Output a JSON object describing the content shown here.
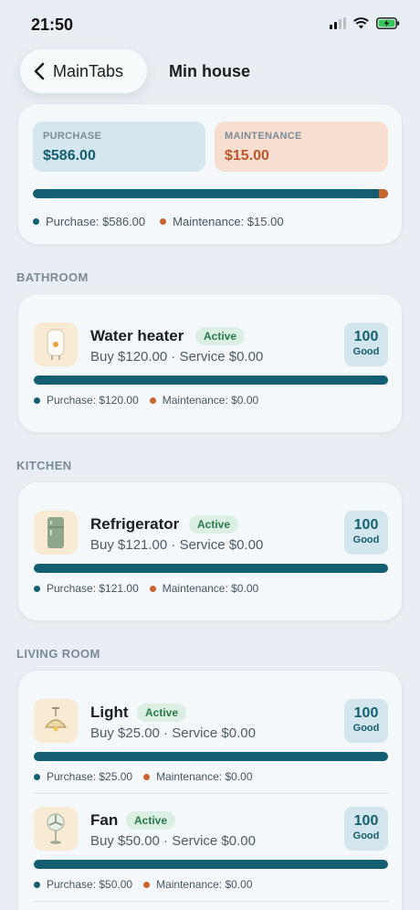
{
  "status_bar": {
    "time": "21:50",
    "icons": [
      "signal-icon",
      "wifi-icon",
      "battery-charging-icon"
    ]
  },
  "header": {
    "back_label": "MainTabs",
    "title": "Min house"
  },
  "summary": {
    "purchase_label": "PURCHASE",
    "purchase_value": "$586.00",
    "maintenance_label": "MAINTENANCE",
    "maintenance_value": "$15.00",
    "purchase_share": 0.975,
    "legend_purchase": "Purchase: $586.00",
    "legend_maintenance": "Maintenance: $15.00"
  },
  "colors": {
    "purchase": "#135e71",
    "maintenance": "#c8652f",
    "background": "#e8eef3"
  },
  "sections": [
    {
      "label": "BATHROOM",
      "items": [
        {
          "name": "Water heater",
          "status": "Active",
          "subtitle": "Buy $120.00 · Service $0.00",
          "score": "100",
          "score_label": "Good",
          "legend_purchase": "Purchase: $120.00",
          "legend_maintenance": "Maintenance: $0.00",
          "icon": "water-heater-icon"
        }
      ]
    },
    {
      "label": "KITCHEN",
      "items": [
        {
          "name": "Refrigerator",
          "status": "Active",
          "subtitle": "Buy $121.00 · Service $0.00",
          "score": "100",
          "score_label": "Good",
          "legend_purchase": "Purchase: $121.00",
          "legend_maintenance": "Maintenance: $0.00",
          "icon": "refrigerator-icon"
        }
      ]
    },
    {
      "label": "LIVING ROOM",
      "items": [
        {
          "name": "Light",
          "status": "Active",
          "subtitle": "Buy $25.00 · Service $0.00",
          "score": "100",
          "score_label": "Good",
          "legend_purchase": "Purchase: $25.00",
          "legend_maintenance": "Maintenance: $0.00",
          "icon": "ceiling-light-icon"
        },
        {
          "name": "Fan",
          "status": "Active",
          "subtitle": "Buy $50.00 · Service $0.00",
          "score": "100",
          "score_label": "Good",
          "legend_purchase": "Purchase: $50.00",
          "legend_maintenance": "Maintenance: $0.00",
          "icon": "fan-icon"
        }
      ]
    }
  ]
}
